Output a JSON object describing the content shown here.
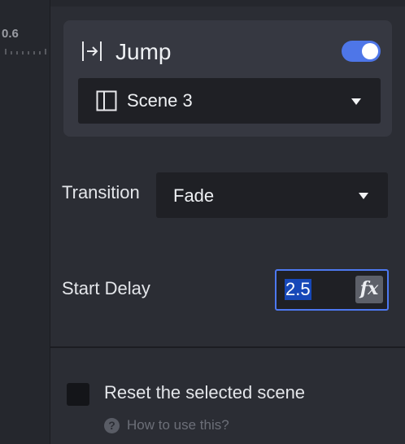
{
  "timeline": {
    "ruler_label": "0.6"
  },
  "action_card": {
    "icon": "jump-icon",
    "title": "Jump",
    "enabled": true,
    "accent_color": "#4e76e8",
    "target": {
      "icon": "scene-icon",
      "value": "Scene 3"
    }
  },
  "transition": {
    "label": "Transition",
    "value": "Fade"
  },
  "start_delay": {
    "label": "Start Delay",
    "value": "2.5",
    "fx_label": "fx"
  },
  "reset": {
    "label": "Reset the selected scene",
    "checked": false
  },
  "help": {
    "icon_glyph": "?",
    "link": "How to use this?"
  }
}
